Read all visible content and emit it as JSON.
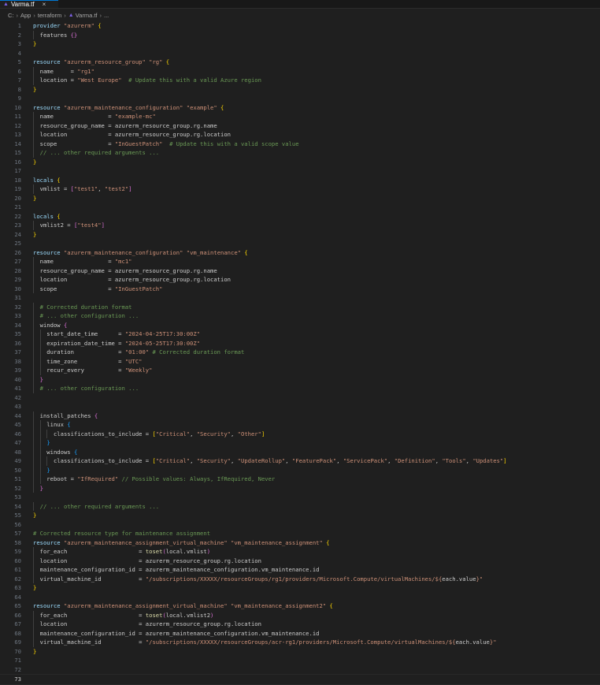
{
  "tab": {
    "title": "Varma.tf",
    "close": "×"
  },
  "breadcrumb": [
    "C:",
    "App",
    "terraform",
    "Varma.tf",
    "..."
  ],
  "colors": {
    "keyword": "#9cdcfe",
    "string": "#ce9178",
    "comment": "#6a9955",
    "function": "#dcdcaa",
    "bracket_1": "#ffd700",
    "bracket_2": "#da70d6",
    "bracket_3": "#179fff",
    "accent": "#0078d4"
  },
  "icons": {
    "file_icon": "terraform-icon",
    "close_icon": "close-icon"
  },
  "current_line": 73,
  "lines": [
    [
      [
        "k",
        "provider "
      ],
      [
        "s",
        "\"azurerm\""
      ],
      [
        "b1",
        " {"
      ]
    ],
    [
      [
        "t",
        "  features "
      ],
      [
        "b2",
        "{}"
      ]
    ],
    [
      [
        "b1",
        "}"
      ]
    ],
    [],
    [
      [
        "k",
        "resource "
      ],
      [
        "s",
        "\"azurerm_resource_group\""
      ],
      [
        "t",
        " "
      ],
      [
        "s",
        "\"rg\""
      ],
      [
        "b1",
        " {"
      ]
    ],
    [
      [
        "t",
        "  name     = "
      ],
      [
        "s",
        "\"rg1\""
      ]
    ],
    [
      [
        "t",
        "  location = "
      ],
      [
        "s",
        "\"West Europe\""
      ],
      [
        "c",
        "  # Update this with a valid Azure region"
      ]
    ],
    [
      [
        "b1",
        "}"
      ]
    ],
    [],
    [
      [
        "k",
        "resource "
      ],
      [
        "s",
        "\"azurerm_maintenance_configuration\""
      ],
      [
        "t",
        " "
      ],
      [
        "s",
        "\"example\""
      ],
      [
        "b1",
        " {"
      ]
    ],
    [
      [
        "t",
        "  name                = "
      ],
      [
        "s",
        "\"example-mc\""
      ]
    ],
    [
      [
        "t",
        "  resource_group_name = azurerm_resource_group.rg.name"
      ]
    ],
    [
      [
        "t",
        "  location            = azurerm_resource_group.rg.location"
      ]
    ],
    [
      [
        "t",
        "  scope               = "
      ],
      [
        "s",
        "\"InGuestPatch\""
      ],
      [
        "c",
        "  # Update this with a valid scope value"
      ]
    ],
    [
      [
        "c",
        "  // ... other required arguments ..."
      ]
    ],
    [
      [
        "b1",
        "}"
      ]
    ],
    [],
    [
      [
        "k",
        "locals "
      ],
      [
        "b1",
        "{"
      ]
    ],
    [
      [
        "t",
        "  vmlist = "
      ],
      [
        "b2",
        "["
      ],
      [
        "s",
        "\"test1\""
      ],
      [
        "t",
        ", "
      ],
      [
        "s",
        "\"test2\""
      ],
      [
        "b2",
        "]"
      ]
    ],
    [
      [
        "b1",
        "}"
      ]
    ],
    [],
    [
      [
        "k",
        "locals "
      ],
      [
        "b1",
        "{"
      ]
    ],
    [
      [
        "t",
        "  vmlist2 = "
      ],
      [
        "b2",
        "["
      ],
      [
        "s",
        "\"test4\""
      ],
      [
        "b2",
        "]"
      ]
    ],
    [
      [
        "b1",
        "}"
      ]
    ],
    [],
    [
      [
        "k",
        "resource "
      ],
      [
        "s",
        "\"azurerm_maintenance_configuration\""
      ],
      [
        "t",
        " "
      ],
      [
        "s",
        "\"vm_maintenance\""
      ],
      [
        "b1",
        " {"
      ]
    ],
    [
      [
        "t",
        "  name                = "
      ],
      [
        "s",
        "\"mc1\""
      ]
    ],
    [
      [
        "t",
        "  resource_group_name = azurerm_resource_group.rg.name"
      ]
    ],
    [
      [
        "t",
        "  location            = azurerm_resource_group.rg.location"
      ]
    ],
    [
      [
        "t",
        "  scope               = "
      ],
      [
        "s",
        "\"InGuestPatch\""
      ]
    ],
    [],
    [
      [
        "c",
        "  # Corrected duration format"
      ]
    ],
    [
      [
        "c",
        "  # ... other configuration ..."
      ]
    ],
    [
      [
        "t",
        "  window "
      ],
      [
        "b2",
        "{"
      ]
    ],
    [
      [
        "t",
        "    start_date_time      = "
      ],
      [
        "s",
        "\"2024-04-25T17:30:00Z\""
      ]
    ],
    [
      [
        "t",
        "    expiration_date_time = "
      ],
      [
        "s",
        "\"2024-05-25T17:30:00Z\""
      ]
    ],
    [
      [
        "t",
        "    duration             = "
      ],
      [
        "s",
        "\"01:00\""
      ],
      [
        "c",
        " # Corrected duration format"
      ]
    ],
    [
      [
        "t",
        "    time_zone            = "
      ],
      [
        "s",
        "\"UTC\""
      ]
    ],
    [
      [
        "t",
        "    recur_every          = "
      ],
      [
        "s",
        "\"Weekly\""
      ]
    ],
    [
      [
        "t",
        "  "
      ],
      [
        "b2",
        "}"
      ]
    ],
    [
      [
        "c",
        "  # ... other configuration ..."
      ]
    ],
    [],
    [],
    [
      [
        "t",
        "  install_patches "
      ],
      [
        "b2",
        "{"
      ]
    ],
    [
      [
        "t",
        "    linux "
      ],
      [
        "b3",
        "{"
      ]
    ],
    [
      [
        "t",
        "      classifications_to_include = "
      ],
      [
        "b1",
        "["
      ],
      [
        "s",
        "\"Critical\""
      ],
      [
        "t",
        ", "
      ],
      [
        "s",
        "\"Security\""
      ],
      [
        "t",
        ", "
      ],
      [
        "s",
        "\"Other\""
      ],
      [
        "b1",
        "]"
      ]
    ],
    [
      [
        "t",
        "    "
      ],
      [
        "b3",
        "}"
      ]
    ],
    [
      [
        "t",
        "    windows "
      ],
      [
        "b3",
        "{"
      ]
    ],
    [
      [
        "t",
        "      classifications_to_include = "
      ],
      [
        "b1",
        "["
      ],
      [
        "s",
        "\"Critical\""
      ],
      [
        "t",
        ", "
      ],
      [
        "s",
        "\"Security\""
      ],
      [
        "t",
        ", "
      ],
      [
        "s",
        "\"UpdateRollup\""
      ],
      [
        "t",
        ", "
      ],
      [
        "s",
        "\"FeaturePack\""
      ],
      [
        "t",
        ", "
      ],
      [
        "s",
        "\"ServicePack\""
      ],
      [
        "t",
        ", "
      ],
      [
        "s",
        "\"Definition\""
      ],
      [
        "t",
        ", "
      ],
      [
        "s",
        "\"Tools\""
      ],
      [
        "t",
        ", "
      ],
      [
        "s",
        "\"Updates\""
      ],
      [
        "b1",
        "]"
      ]
    ],
    [
      [
        "t",
        "    "
      ],
      [
        "b3",
        "}"
      ]
    ],
    [
      [
        "t",
        "    reboot = "
      ],
      [
        "s",
        "\"IfRequired\""
      ],
      [
        "c",
        " // Possible values: Always, IfRequired, Never"
      ]
    ],
    [
      [
        "t",
        "  "
      ],
      [
        "b2",
        "}"
      ]
    ],
    [],
    [
      [
        "c",
        "  // ... other required arguments ..."
      ]
    ],
    [
      [
        "b1",
        "}"
      ]
    ],
    [],
    [
      [
        "c",
        "# Corrected resource type for maintenance assignment"
      ]
    ],
    [
      [
        "k",
        "resource "
      ],
      [
        "s",
        "\"azurerm_maintenance_assignment_virtual_machine\""
      ],
      [
        "t",
        " "
      ],
      [
        "s",
        "\"vm_maintenance_assignment\""
      ],
      [
        "b1",
        " {"
      ]
    ],
    [
      [
        "t",
        "  for_each                     = "
      ],
      [
        "f",
        "toset"
      ],
      [
        "b2",
        "("
      ],
      [
        "t",
        "local.vmlist"
      ],
      [
        "b2",
        ")"
      ]
    ],
    [
      [
        "t",
        "  location                     = azurerm_resource_group.rg.location"
      ]
    ],
    [
      [
        "t",
        "  maintenance_configuration_id = azurerm_maintenance_configuration.vm_maintenance.id"
      ]
    ],
    [
      [
        "t",
        "  virtual_machine_id           = "
      ],
      [
        "s",
        "\"/subscriptions/XXXXX/resourceGroups/rg1/providers/Microsoft.Compute/virtualMachines/${"
      ],
      [
        "t",
        "each.value"
      ],
      [
        "s",
        "}\""
      ]
    ],
    [
      [
        "b1",
        "}"
      ]
    ],
    [],
    [
      [
        "k",
        "resource "
      ],
      [
        "s",
        "\"azurerm_maintenance_assignment_virtual_machine\""
      ],
      [
        "t",
        " "
      ],
      [
        "s",
        "\"vm_maintenance_assignment2\""
      ],
      [
        "b1",
        " {"
      ]
    ],
    [
      [
        "t",
        "  for_each                     = "
      ],
      [
        "f",
        "toset"
      ],
      [
        "b2",
        "("
      ],
      [
        "t",
        "local.vmlist2"
      ],
      [
        "b2",
        ")"
      ]
    ],
    [
      [
        "t",
        "  location                     = azurerm_resource_group.rg.location"
      ]
    ],
    [
      [
        "t",
        "  maintenance_configuration_id = azurerm_maintenance_configuration.vm_maintenance.id"
      ]
    ],
    [
      [
        "t",
        "  virtual_machine_id           = "
      ],
      [
        "s",
        "\"/subscriptions/XXXXX/resourceGroups/acr-rg1/providers/Microsoft.Compute/virtualMachines/${"
      ],
      [
        "t",
        "each.value"
      ],
      [
        "s",
        "}\""
      ]
    ],
    [
      [
        "b1",
        "}"
      ]
    ],
    [],
    [],
    []
  ]
}
